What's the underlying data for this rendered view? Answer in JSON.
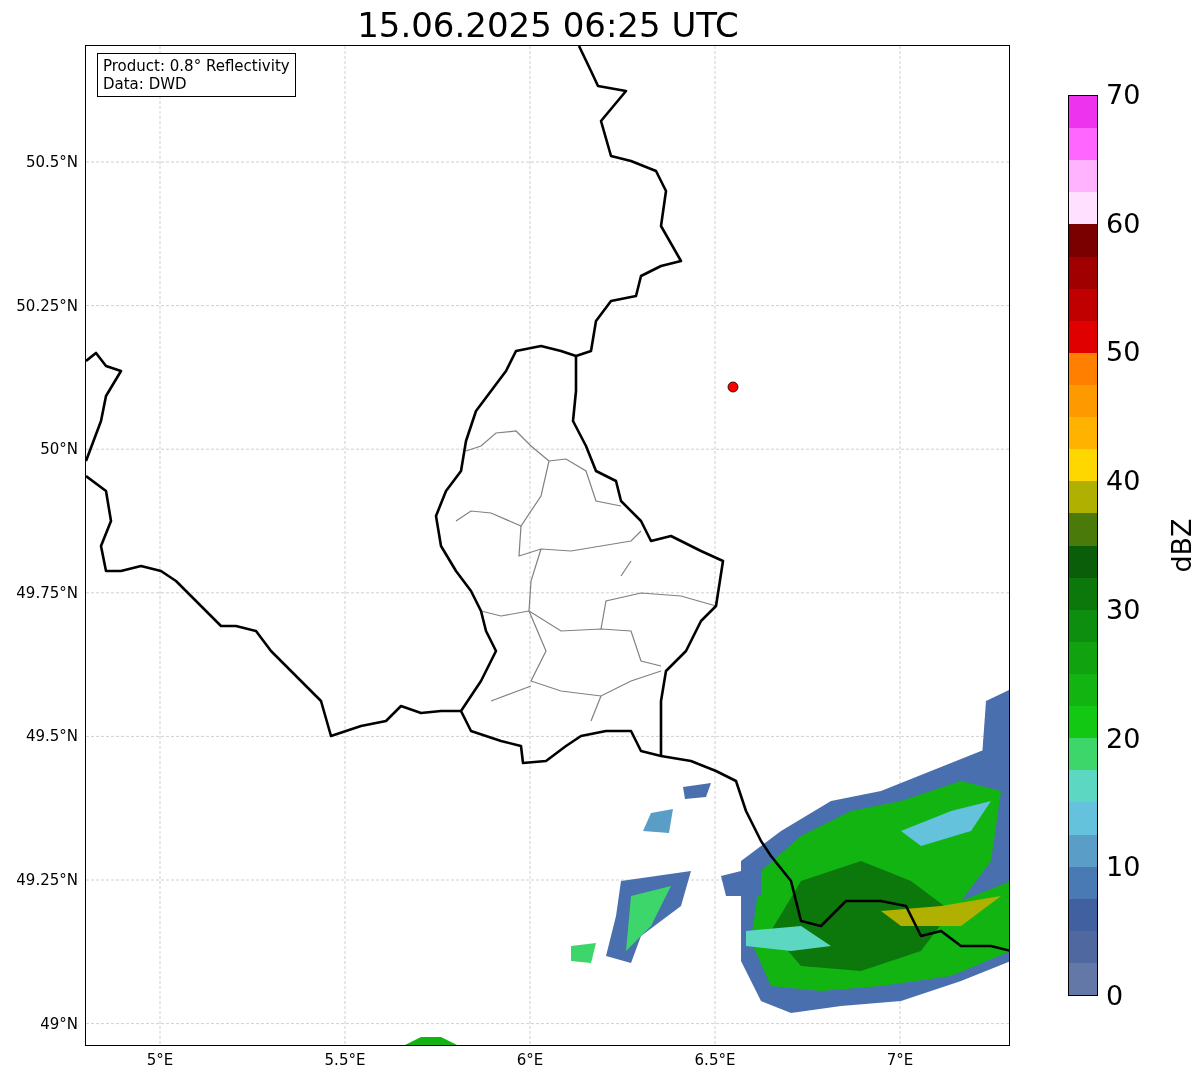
{
  "title": "15.06.2025 06:25 UTC",
  "legend": {
    "lines": [
      "Product: 0.8° Reflectivity",
      "Data: DWD"
    ]
  },
  "map": {
    "latitude_labels": [
      "50.5°N",
      "50.25°N",
      "50°N",
      "49.75°N",
      "49.5°N",
      "49.25°N",
      "49°N"
    ],
    "longitude_labels": [
      "5°E",
      "5.5°E",
      "6°E",
      "6.5°E",
      "7°E"
    ]
  },
  "colorbar": {
    "label": "dBZ",
    "ticks": [
      "70",
      "60",
      "50",
      "40",
      "30",
      "20",
      "10",
      "0"
    ],
    "segments": [
      {
        "color": "#ee33ee"
      },
      {
        "color": "#ff66ff"
      },
      {
        "color": "#ffb3ff"
      },
      {
        "color": "#ffe0ff"
      },
      {
        "color": "#7a0000"
      },
      {
        "color": "#a00000"
      },
      {
        "color": "#c00000"
      },
      {
        "color": "#e00000"
      },
      {
        "color": "#ff7f00"
      },
      {
        "color": "#ff9900"
      },
      {
        "color": "#ffb300"
      },
      {
        "color": "#ffd700"
      },
      {
        "color": "#b0b000"
      },
      {
        "color": "#4a7a0a"
      },
      {
        "color": "#0a5e0a"
      },
      {
        "color": "#0c780c"
      },
      {
        "color": "#0e8e0e"
      },
      {
        "color": "#10a20f"
      },
      {
        "color": "#12b412"
      },
      {
        "color": "#12c812"
      },
      {
        "color": "#3cd66a"
      },
      {
        "color": "#5cd8c2"
      },
      {
        "color": "#64c2dc"
      },
      {
        "color": "#5a9ec8"
      },
      {
        "color": "#4a7ab4"
      },
      {
        "color": "#4060a0"
      },
      {
        "color": "#5068a0"
      },
      {
        "color": "#6478a8"
      }
    ]
  }
}
